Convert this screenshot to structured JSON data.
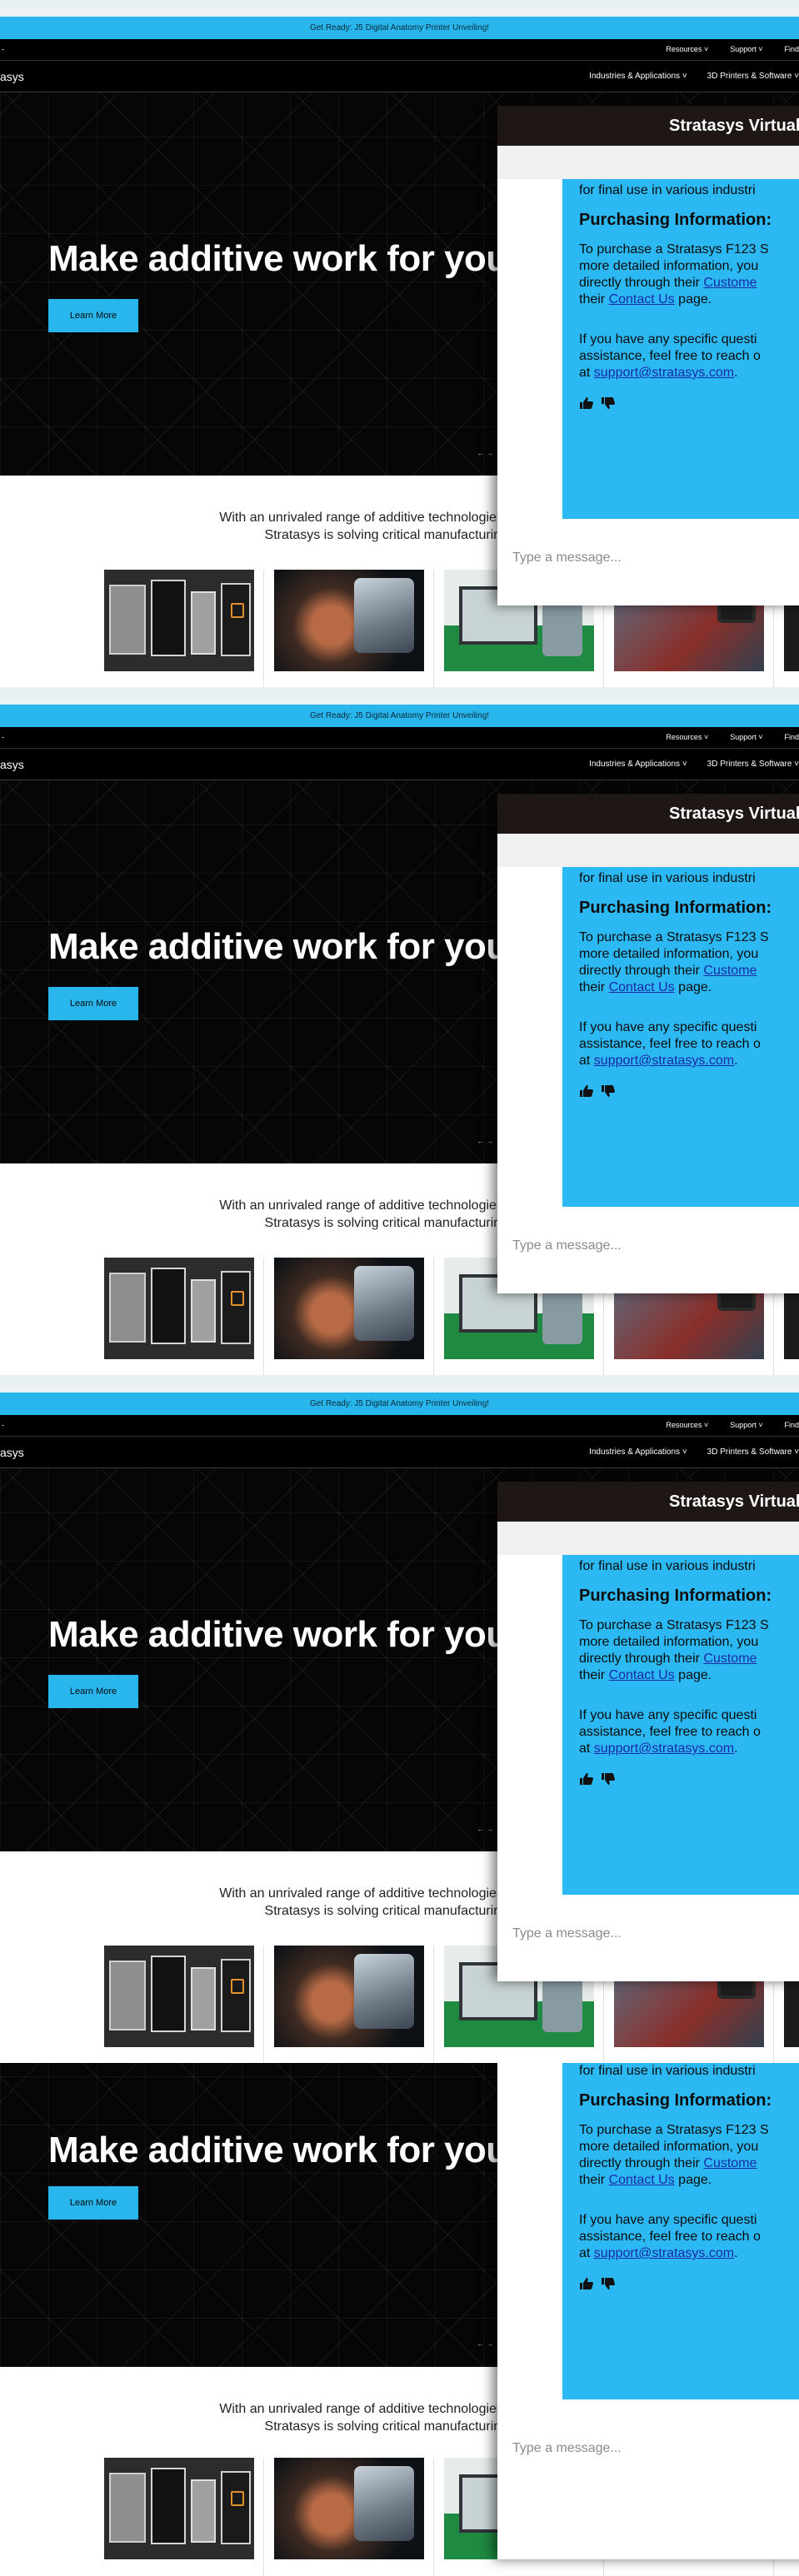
{
  "announcement": "Get Ready: J5 Digital Anatomy Printer Unveiling!",
  "topbar": {
    "left_glyph": "-",
    "links": [
      "Resources ˅",
      "Support ˅",
      "Find"
    ]
  },
  "nav": {
    "logo": "asys",
    "menu": [
      "Industries & Applications ˅",
      "3D Printers & Software ˅"
    ]
  },
  "hero": {
    "headline": "Make additive work for you",
    "cta": "Learn More",
    "pager": "← →"
  },
  "intro": {
    "line1": "With an unrivaled range of additive technologies, materials",
    "line2": "Stratasys is solving critical manufacturing ch"
  },
  "thumbs": [
    "3D printer lineup",
    "Hand holding printed part",
    "Workstation with software",
    "Operator with printed parts",
    "Printer detail"
  ],
  "chat": {
    "title": "Stratasys Virtual",
    "message": {
      "partial_line": "for final use in various industri",
      "heading": "Purchasing Information:",
      "p1_line1": "To purchase a Stratasys F123 S",
      "p1_line2": "more detailed information, you",
      "p1_line3_pre": "directly through their ",
      "p1_line3_link": "Custome",
      "p1_line4_pre": "their ",
      "p1_line4_link": "Contact Us",
      "p1_line4_post": " page.",
      "p2_line1": "If you have any specific questi",
      "p2_line2": "assistance, feel free to reach o",
      "p2_line3_pre": "at ",
      "p2_line3_link": "support@stratasys.com",
      "p2_line3_post": "."
    },
    "input_placeholder": "Type a message..."
  },
  "icons": [
    "thumbs-up-icon",
    "thumbs-down-icon"
  ]
}
